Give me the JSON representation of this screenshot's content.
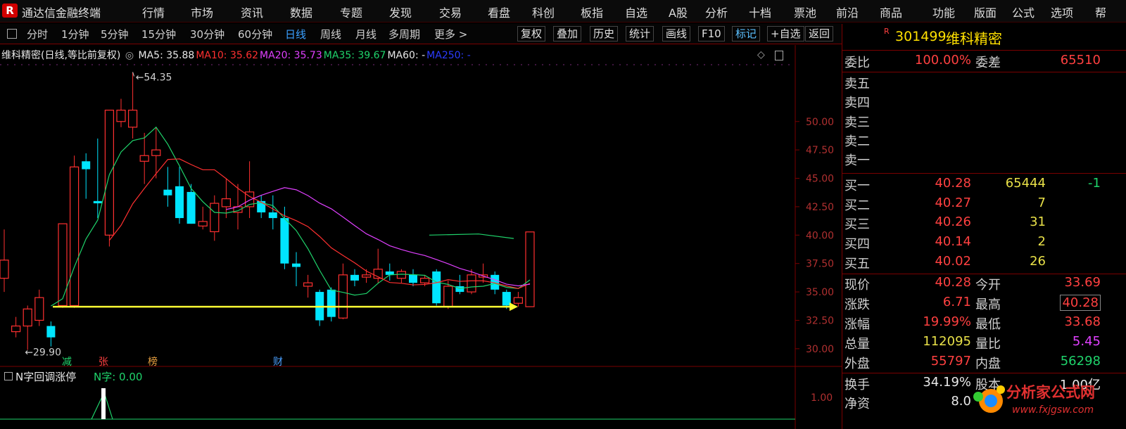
{
  "app": {
    "title": "通达信金融终端",
    "logo": "R"
  },
  "menu": [
    "行情",
    "市场",
    "资讯",
    "数据",
    "专题",
    "发现",
    "交易",
    "看盘",
    "科创",
    "板指",
    "自选",
    "A股",
    "分析",
    "十档",
    "票池",
    "前沿",
    "商品",
    "功能",
    "版面",
    "公式",
    "选项",
    "帮"
  ],
  "toolbar": {
    "periods": [
      "分时",
      "1分钟",
      "5分钟",
      "15分钟",
      "30分钟",
      "60分钟",
      "日线",
      "周线",
      "月线",
      "多周期",
      "更多 >"
    ],
    "active_period": "日线",
    "buttons": [
      "复权",
      "叠加",
      "历史",
      "统计",
      "画线",
      "F10",
      "标记",
      "+自选",
      "返回"
    ]
  },
  "chart": {
    "title": "维科精密(日线,等比前复权)",
    "ma": [
      {
        "label": "MA5: 35.88",
        "color": "#e8e8e8"
      },
      {
        "label": "MA10: 35.62",
        "color": "#ff3030"
      },
      {
        "label": "MA20: 35.73",
        "color": "#e040ff"
      },
      {
        "label": "MA35: 39.67",
        "color": "#1fd36b"
      },
      {
        "label": "MA60: -",
        "color": "#e8e8e8"
      },
      {
        "label": "MA250: -",
        "color": "#2b3cff"
      }
    ],
    "price_labels": [
      "50.00",
      "47.50",
      "45.00",
      "42.50",
      "40.00",
      "37.50",
      "35.00",
      "32.50",
      "30.00"
    ],
    "high_label": "54.35",
    "low_label": "29.90",
    "event_tags": [
      {
        "text": "减",
        "color": "#1fd36b"
      },
      {
        "text": "张",
        "color": "#ff4040"
      },
      {
        "text": "榜",
        "color": "#e8a040"
      },
      {
        "text": "财",
        "color": "#4aa0ff"
      }
    ],
    "indicator_title": "N字回调涨停",
    "indicator_value": "N字: 0.00",
    "indicator_axis": "1.00"
  },
  "chart_data": {
    "type": "candlestick",
    "ylim": [
      29.0,
      55.0
    ],
    "candles": [
      [
        36.2,
        37.8,
        35.0,
        40.5
      ],
      [
        31.5,
        32.0,
        31.0,
        32.8
      ],
      [
        32.0,
        33.5,
        29.9,
        33.8
      ],
      [
        32.5,
        34.5,
        32.0,
        35.2
      ],
      [
        32.0,
        31.0,
        30.2,
        32.4
      ],
      [
        33.8,
        41.0,
        33.6,
        41.0
      ],
      [
        33.8,
        46.0,
        33.6,
        47.0
      ],
      [
        46.5,
        45.8,
        43.2,
        47.2
      ],
      [
        43.0,
        42.8,
        41.5,
        48.5
      ],
      [
        40.0,
        51.0,
        39.0,
        51.0
      ],
      [
        50.0,
        51.0,
        49.5,
        52.0
      ],
      [
        49.5,
        51.0,
        48.5,
        54.35
      ],
      [
        46.5,
        47.0,
        44.5,
        49.0
      ],
      [
        47.0,
        47.5,
        45.0,
        49.5
      ],
      [
        44.0,
        43.5,
        42.5,
        46.0
      ],
      [
        44.3,
        41.5,
        41.0,
        46.0
      ],
      [
        43.8,
        41.0,
        41.0,
        44.5
      ],
      [
        40.8,
        41.2,
        40.5,
        42.5
      ],
      [
        40.3,
        42.8,
        39.5,
        43.5
      ],
      [
        42.5,
        43.2,
        41.5,
        45.0
      ],
      [
        42.0,
        42.5,
        40.5,
        44.5
      ],
      [
        42.5,
        43.8,
        41.5,
        46.5
      ],
      [
        43.0,
        42.0,
        41.5,
        43.5
      ],
      [
        42.0,
        41.5,
        40.5,
        43.5
      ],
      [
        41.5,
        37.5,
        37.0,
        42.5
      ],
      [
        37.5,
        37.2,
        35.5,
        38.5
      ],
      [
        35.5,
        35.8,
        34.5,
        36.5
      ],
      [
        35.0,
        32.5,
        32.0,
        35.2
      ],
      [
        35.2,
        32.8,
        32.4,
        35.4
      ],
      [
        32.7,
        36.5,
        32.6,
        37.5
      ],
      [
        36.5,
        36.0,
        35.5,
        37.0
      ],
      [
        36.3,
        36.5,
        35.8,
        37.0
      ],
      [
        36.2,
        37.0,
        35.8,
        38.8
      ],
      [
        36.8,
        36.5,
        36.0,
        37.5
      ],
      [
        36.2,
        36.8,
        35.8,
        37.0
      ],
      [
        36.5,
        35.8,
        35.5,
        37.0
      ],
      [
        35.8,
        36.2,
        35.5,
        36.5
      ],
      [
        36.8,
        34.0,
        33.8,
        37.0
      ],
      [
        33.7,
        35.5,
        33.5,
        36.0
      ],
      [
        35.5,
        35.0,
        34.8,
        36.5
      ],
      [
        35.0,
        36.5,
        34.8,
        37.0
      ],
      [
        36.3,
        36.5,
        35.8,
        37.5
      ],
      [
        36.5,
        35.2,
        34.8,
        36.8
      ],
      [
        35.0,
        33.8,
        33.5,
        35.2
      ],
      [
        34.0,
        34.5,
        33.7,
        35.0
      ],
      [
        33.7,
        40.28,
        33.68,
        40.28
      ]
    ]
  },
  "quote": {
    "code": "301499",
    "name": "维科精密",
    "webi_label": "委比",
    "webi": "100.00%",
    "weicha_label": "委差",
    "weicha": "65510",
    "sell_labels": [
      "卖五",
      "卖四",
      "卖三",
      "卖二",
      "卖一"
    ],
    "buy": [
      {
        "label": "买一",
        "price": "40.28",
        "vol": "65444",
        "chg": "-1"
      },
      {
        "label": "买二",
        "price": "40.27",
        "vol": "7",
        "chg": ""
      },
      {
        "label": "买三",
        "price": "40.26",
        "vol": "31",
        "chg": ""
      },
      {
        "label": "买四",
        "price": "40.14",
        "vol": "2",
        "chg": ""
      },
      {
        "label": "买五",
        "price": "40.02",
        "vol": "26",
        "chg": ""
      }
    ],
    "stats_left": [
      {
        "label": "现价",
        "value": "40.28",
        "cls": "red"
      },
      {
        "label": "涨跌",
        "value": "6.71",
        "cls": "red"
      },
      {
        "label": "涨幅",
        "value": "19.99%",
        "cls": "red"
      },
      {
        "label": "总量",
        "value": "112095",
        "cls": "yellow"
      },
      {
        "label": "外盘",
        "value": "55797",
        "cls": "red"
      },
      {
        "label": "换手",
        "value": "34.19%",
        "cls": "white"
      },
      {
        "label": "净资",
        "value": "8.0",
        "cls": "white"
      }
    ],
    "stats_right": [
      {
        "label": "今开",
        "value": "33.69",
        "cls": "red"
      },
      {
        "label": "最高",
        "value": "40.28",
        "cls": "red"
      },
      {
        "label": "最低",
        "value": "33.68",
        "cls": "red"
      },
      {
        "label": "量比",
        "value": "5.45",
        "cls": "magenta"
      },
      {
        "label": "内盘",
        "value": "56298",
        "cls": "green"
      },
      {
        "label": "股本",
        "value": "1.00亿",
        "cls": "white"
      }
    ]
  },
  "watermark": {
    "text1": "分析家公式网",
    "text2": "www.fxjgsw.com"
  }
}
